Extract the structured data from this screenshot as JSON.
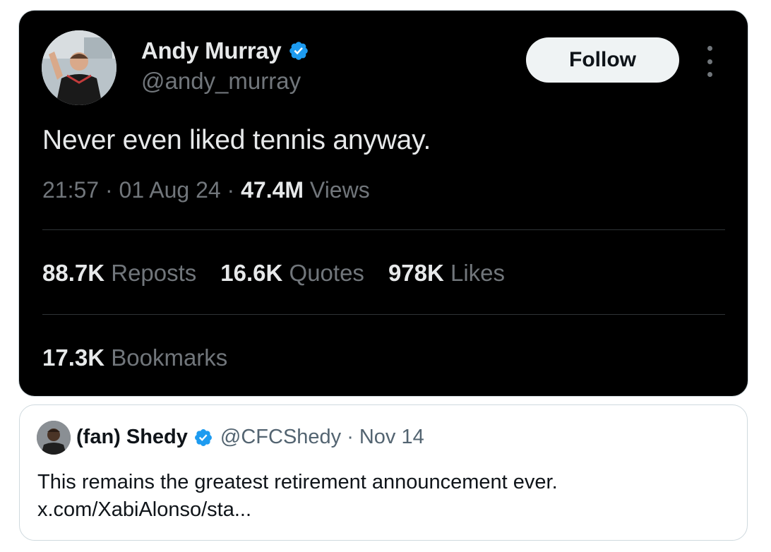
{
  "tweet": {
    "author": {
      "display_name": "Andy Murray",
      "handle": "@andy_murray",
      "verified": true
    },
    "follow_label": "Follow",
    "text": "Never even liked tennis anyway.",
    "meta": {
      "time": "21:57",
      "separator": "·",
      "date": "01 Aug 24",
      "views_count": "47.4M",
      "views_label": "Views"
    },
    "stats": {
      "reposts_count": "88.7K",
      "reposts_label": "Reposts",
      "quotes_count": "16.6K",
      "quotes_label": "Quotes",
      "likes_count": "978K",
      "likes_label": "Likes",
      "bookmarks_count": "17.3K",
      "bookmarks_label": "Bookmarks"
    }
  },
  "quote": {
    "display_name": "(fan) Shedy",
    "handle": "@CFCShedy",
    "separator": "·",
    "date": "Nov 14",
    "text": "This remains the greatest retirement announcement ever.",
    "link": "x.com/XabiAlonso/sta..."
  },
  "colors": {
    "verified_blue": "#1d9bf0",
    "dark_background": "#000000",
    "muted_text": "#71767b",
    "follow_button": "#eff3f4"
  }
}
